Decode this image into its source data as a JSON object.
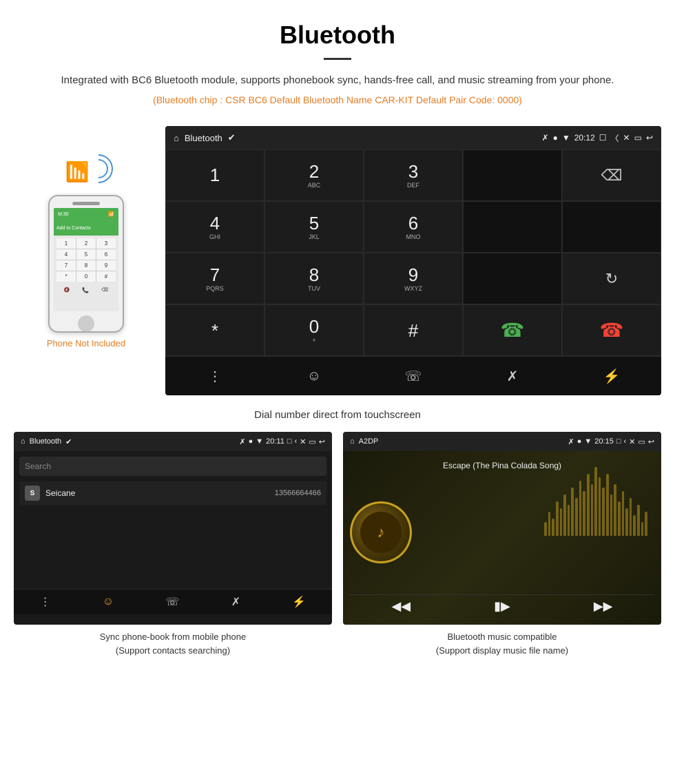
{
  "header": {
    "title": "Bluetooth",
    "description": "Integrated with BC6 Bluetooth module, supports phonebook sync, hands-free call, and music streaming from your phone.",
    "specs": "(Bluetooth chip : CSR BC6    Default Bluetooth Name CAR-KIT    Default Pair Code: 0000)"
  },
  "dial_screen": {
    "status_title": "Bluetooth",
    "time": "20:12",
    "keys": [
      {
        "num": "1",
        "sub": ""
      },
      {
        "num": "2",
        "sub": "ABC"
      },
      {
        "num": "3",
        "sub": "DEF"
      },
      {
        "num": "4",
        "sub": "GHI"
      },
      {
        "num": "5",
        "sub": "JKL"
      },
      {
        "num": "6",
        "sub": "MNO"
      },
      {
        "num": "7",
        "sub": "PQRS"
      },
      {
        "num": "8",
        "sub": "TUV"
      },
      {
        "num": "9",
        "sub": "WXYZ"
      },
      {
        "num": "*",
        "sub": ""
      },
      {
        "num": "0",
        "sub": "+"
      },
      {
        "num": "#",
        "sub": ""
      }
    ]
  },
  "caption": "Dial number direct from touchscreen",
  "phonebook_screen": {
    "title": "Bluetooth",
    "time": "20:11",
    "search_placeholder": "Search",
    "contact_initial": "S",
    "contact_name": "Seicane",
    "contact_phone": "13566664466"
  },
  "music_screen": {
    "title": "A2DP",
    "time": "20:15",
    "song_title": "Escape (The Pina Colada Song)"
  },
  "phone_label": "Phone Not Included",
  "phonebook_caption_line1": "Sync phone-book from mobile phone",
  "phonebook_caption_line2": "(Support contacts searching)",
  "music_caption_line1": "Bluetooth music compatible",
  "music_caption_line2": "(Support display music file name)"
}
